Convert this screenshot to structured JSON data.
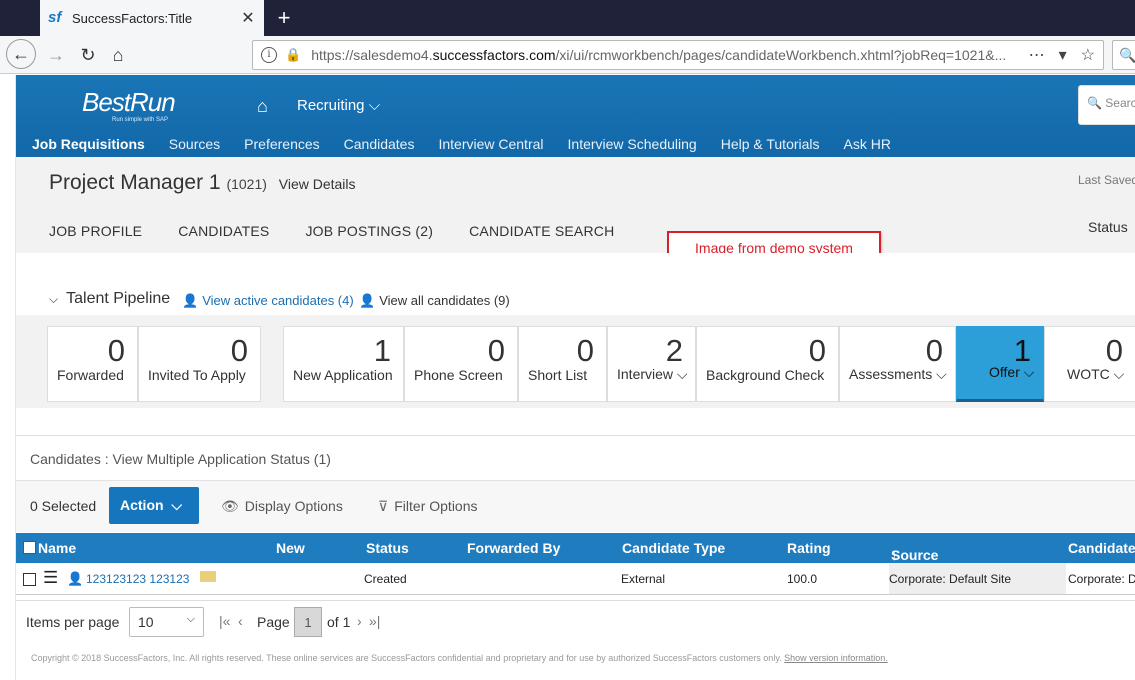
{
  "browser": {
    "tab_title": "SuccessFactors:Title",
    "tab_icon_text": "sf",
    "url_prefix": "https://salesdemo4.",
    "url_domain": "successfactors.com",
    "url_rest": "/xi/ui/rcmworkbench/pages/candidateWorkbench.xhtml?jobReq=1021&..."
  },
  "header": {
    "logo": "BestRun",
    "logo_tagline": "Run simple with SAP",
    "module": "Recruiting",
    "search_placeholder": "Search",
    "nav": [
      "Job Requisitions",
      "Sources",
      "Preferences",
      "Candidates",
      "Interview Central",
      "Interview Scheduling",
      "Help & Tutorials",
      "Ask HR"
    ]
  },
  "requisition": {
    "title": "Project Manager 1",
    "id": "(1021)",
    "view_details": "View Details",
    "last_saved": "Last Saved",
    "status_label": "Status",
    "tabs": [
      "JOB PROFILE",
      "CANDIDATES",
      "JOB POSTINGS (2)",
      "CANDIDATE SEARCH"
    ]
  },
  "annotation": "Image from demo system",
  "pipeline": {
    "title": "Talent Pipeline",
    "active_link": "View active candidates (4)",
    "all_link": "View all candidates (9)",
    "stages": [
      {
        "label": "Forwarded",
        "count": "0"
      },
      {
        "label": "Invited To Apply",
        "count": "0"
      },
      {
        "label": "New Application",
        "count": "1"
      },
      {
        "label": "Phone Screen",
        "count": "0"
      },
      {
        "label": "Short List",
        "count": "0"
      },
      {
        "label": "Interview",
        "count": "2"
      },
      {
        "label": "Background Check",
        "count": "0"
      },
      {
        "label": "Assessments",
        "count": "0"
      },
      {
        "label": "Offer",
        "count": "1"
      },
      {
        "label": "WOTC",
        "count": "0"
      }
    ]
  },
  "candidates": {
    "title": "Candidates : View Multiple Application Status (1)",
    "selected": "0 Selected",
    "action": "Action",
    "display_options": "Display Options",
    "filter_options": "Filter Options",
    "columns": [
      "Name",
      "New",
      "Status",
      "Forwarded By",
      "Candidate Type",
      "Rating",
      "Source",
      "Candidate"
    ],
    "rows": [
      {
        "name": "123123123 123123",
        "new": "",
        "status": "Created",
        "forwarded_by": "",
        "type": "External",
        "rating": "100.0",
        "source": "Corporate: Default Site",
        "candidate": "Corporate: D"
      }
    ]
  },
  "pager": {
    "items_per_page_label": "Items per page",
    "items_per_page": "10",
    "page_label": "Page",
    "page": "1",
    "of_label": "of 1"
  },
  "footer": {
    "text": "Copyright © 2018 SuccessFactors, Inc. All rights reserved. These online services are SuccessFactors confidential and proprietary and for use by authorized SuccessFactors customers only.",
    "link": "Show version information."
  }
}
